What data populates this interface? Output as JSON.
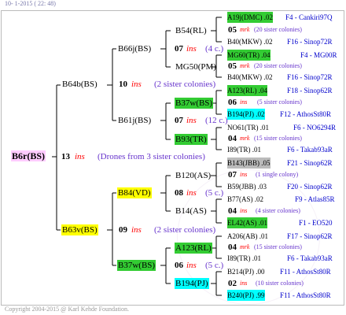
{
  "header": {
    "top_text": "10-  1-2015 ( 22: 48)"
  },
  "footer": {
    "copyright": "Copyright 2004-2015 @ Karl Kehde Foundation."
  },
  "root": {
    "name": "B6r(BS)",
    "num": "13",
    "ins": "ins",
    "note": "(Drones from 3 sister colonies)"
  },
  "gen1": [
    {
      "name": "B64b(BS)",
      "num": "10",
      "ins": "ins",
      "note": "(2 sister colonies)"
    },
    {
      "name": "B63v(BS)",
      "num": "09",
      "ins": "ins",
      "note": "(2 sister colonies)"
    }
  ],
  "gen2": [
    {
      "name": "B66j(BS)",
      "num": "07",
      "ins": "ins",
      "note": "(4 c.)"
    },
    {
      "name": "B61j(BS)",
      "num": "07",
      "ins": "ins",
      "note": "(12 c.)"
    },
    {
      "name": "B84(VD)",
      "num": "08",
      "ins": "ins",
      "note": "(5 c.)"
    },
    {
      "name": "B37w(BS)",
      "num": "06",
      "ins": "ins",
      "note": "(5 c.)"
    }
  ],
  "gen3": [
    {
      "name": "B54(RL)",
      "num": "05",
      "ins": "mrk",
      "note": "(20 sister colonies)"
    },
    {
      "name": "MG50(PM)",
      "num": "05",
      "ins": "mrk",
      "note": "(20 sister colonies)"
    },
    {
      "name": "B37w(BS)",
      "num": "06",
      "ins": "ins",
      "note": "(5 sister colonies)"
    },
    {
      "name": "B93(TR)",
      "num": "04",
      "ins": "mrk",
      "note": "(15 sister colonies)"
    },
    {
      "name": "B120(AS)",
      "num": "07",
      "ins": "ins",
      "note": "(1 single colony)"
    },
    {
      "name": "B14(AS)",
      "num": "04",
      "ins": "ins",
      "note": "(4 sister colonies)"
    },
    {
      "name": "A123(RL)",
      "num": "04",
      "ins": "mrk",
      "note": "(15 sister colonies)"
    },
    {
      "name": "B194(PJ)",
      "num": "02",
      "ins": "ins",
      "note": "(10 sister colonies)"
    }
  ],
  "gen4": [
    {
      "name": "A19j(DMC)",
      "val": ".02",
      "loc": "F4 - Cankiri97Q"
    },
    {
      "name": "B40(MKW)",
      "val": ".02",
      "loc": "F16 - Sinop72R"
    },
    {
      "name": "MG60(TR)",
      "val": ".04",
      "loc": "F4 - MG00R"
    },
    {
      "name": "B40(MKW)",
      "val": ".02",
      "loc": "F16 - Sinop72R"
    },
    {
      "name": "A123(RL)",
      "val": ".04",
      "loc": "F18 - Sinop62R"
    },
    {
      "name": "B194(PJ)",
      "val": ".02",
      "loc": "F12 - AthosSt80R"
    },
    {
      "name": "NO61(TR)",
      "val": ".01",
      "loc": "F6 - NO6294R"
    },
    {
      "name": "I89(TR)",
      "val": ".01",
      "loc": "F6 - Takab93aR"
    },
    {
      "name": "B143(JBB)",
      "val": ".05",
      "loc": "F21 - Sinop62R"
    },
    {
      "name": "B59(JBB)",
      "val": ".03",
      "loc": "F20 - Sinop62R"
    },
    {
      "name": "B77(AS)",
      "val": ".02",
      "loc": "F9 - Atlas85R"
    },
    {
      "name": "EL42(AS)",
      "val": ".01",
      "loc": "F1 - EO520"
    },
    {
      "name": "A206(AB)",
      "val": ".01",
      "loc": "F17 - Sinop62R"
    },
    {
      "name": "I89(TR)",
      "val": ".01",
      "loc": "F6 - Takab93aR"
    },
    {
      "name": "B214(PJ)",
      "val": ".00",
      "loc": "F11 - AthosSt80R"
    },
    {
      "name": "B240(PJ)",
      "val": ".99",
      "loc": "F11 - AthosSt80R"
    }
  ]
}
